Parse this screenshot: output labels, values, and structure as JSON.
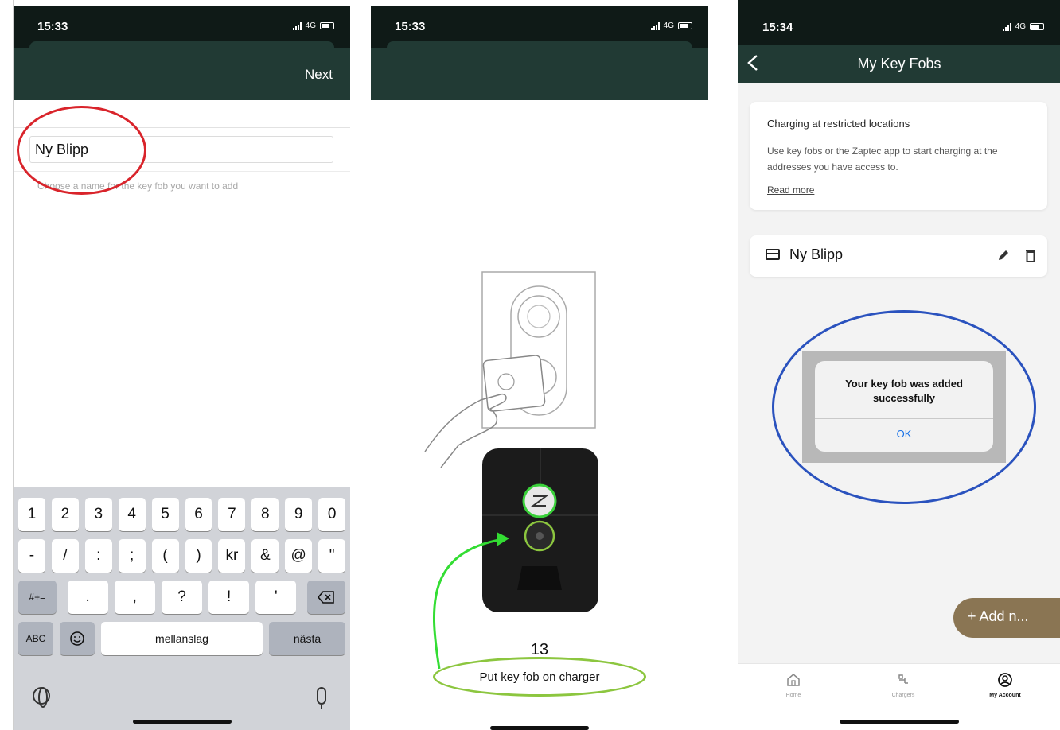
{
  "screen1": {
    "status_time": "15:33",
    "status_network": "4G",
    "next_label": "Next",
    "name_value": "Ny Blipp",
    "hint": "Choose a name for the key fob you want to add",
    "keyboard": {
      "row1": [
        "1",
        "2",
        "3",
        "4",
        "5",
        "6",
        "7",
        "8",
        "9",
        "0"
      ],
      "row2": [
        "-",
        "/",
        ":",
        ";",
        "(",
        ")",
        "kr",
        "&",
        "@",
        "\""
      ],
      "row3_mode": "#+=",
      "row3": [
        ".",
        ",",
        "?",
        "!",
        "'"
      ],
      "row4_abc": "ABC",
      "space": "mellanslag",
      "return": "nästa"
    }
  },
  "screen2": {
    "status_time": "15:33",
    "status_network": "4G",
    "countdown": "13",
    "instruction": "Put key fob on charger"
  },
  "screen3": {
    "status_time": "15:34",
    "status_network": "4G",
    "title": "My Key Fobs",
    "info_title": "Charging at restricted locations",
    "info_body": "Use key fobs or the Zaptec app to start charging at the addresses you have access to.",
    "read_more": "Read more",
    "fob_name": "Ny Blipp",
    "alert_message": "Your key fob was added successfully",
    "alert_ok": "OK",
    "add_button": "+ Add n...",
    "tabs": [
      {
        "label": "Home"
      },
      {
        "label": "Chargers"
      },
      {
        "label": "My Account"
      }
    ]
  },
  "colors": {
    "appbar": "#213a34",
    "accent_red": "#d9242b",
    "accent_green": "#33dd33",
    "accent_blue": "#2a52be",
    "fab": "#8a7553"
  }
}
